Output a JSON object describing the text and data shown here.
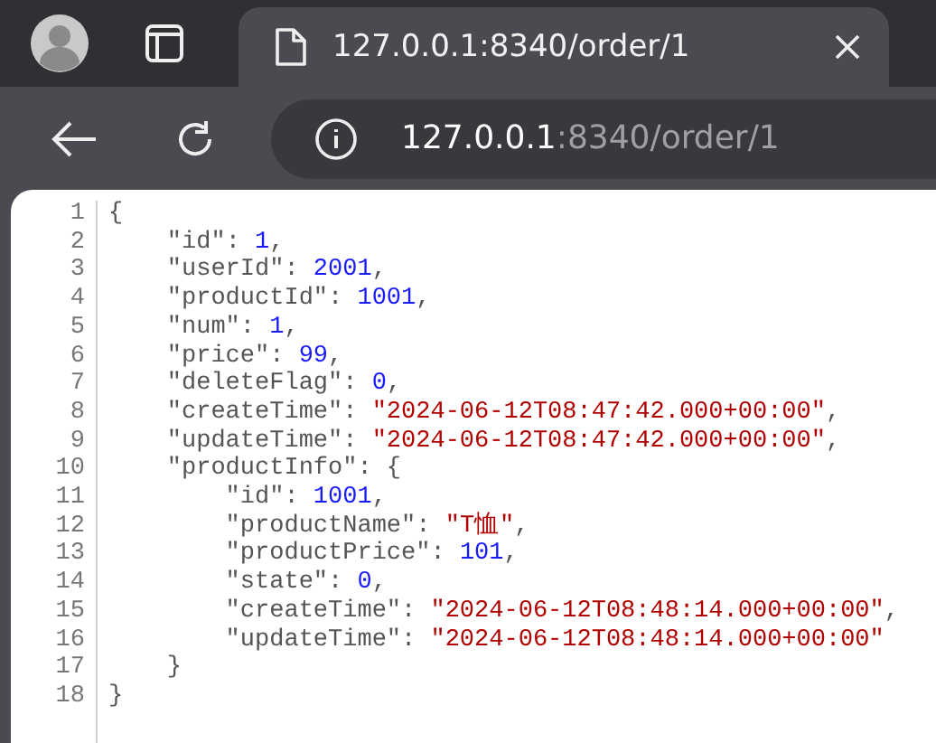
{
  "tab": {
    "title": "127.0.0.1:8340/order/1",
    "selected": true
  },
  "address": {
    "host": "127.0.0.1",
    "rest": ":8340/order/1"
  },
  "code_lines": [
    {
      "number": "1",
      "tokens": [
        {
          "kind": "punct",
          "text": "{"
        }
      ]
    },
    {
      "number": "2",
      "tokens": [
        {
          "kind": "key",
          "text": "    \"id\""
        },
        {
          "kind": "punct",
          "text": ": "
        },
        {
          "kind": "number",
          "text": "1"
        },
        {
          "kind": "punct",
          "text": ","
        }
      ]
    },
    {
      "number": "3",
      "tokens": [
        {
          "kind": "key",
          "text": "    \"userId\""
        },
        {
          "kind": "punct",
          "text": ": "
        },
        {
          "kind": "number",
          "text": "2001"
        },
        {
          "kind": "punct",
          "text": ","
        }
      ]
    },
    {
      "number": "4",
      "tokens": [
        {
          "kind": "key",
          "text": "    \"productId\""
        },
        {
          "kind": "punct",
          "text": ": "
        },
        {
          "kind": "number",
          "text": "1001"
        },
        {
          "kind": "punct",
          "text": ","
        }
      ]
    },
    {
      "number": "5",
      "tokens": [
        {
          "kind": "key",
          "text": "    \"num\""
        },
        {
          "kind": "punct",
          "text": ": "
        },
        {
          "kind": "number",
          "text": "1"
        },
        {
          "kind": "punct",
          "text": ","
        }
      ]
    },
    {
      "number": "6",
      "tokens": [
        {
          "kind": "key",
          "text": "    \"price\""
        },
        {
          "kind": "punct",
          "text": ": "
        },
        {
          "kind": "number",
          "text": "99"
        },
        {
          "kind": "punct",
          "text": ","
        }
      ]
    },
    {
      "number": "7",
      "tokens": [
        {
          "kind": "key",
          "text": "    \"deleteFlag\""
        },
        {
          "kind": "punct",
          "text": ": "
        },
        {
          "kind": "number",
          "text": "0"
        },
        {
          "kind": "punct",
          "text": ","
        }
      ]
    },
    {
      "number": "8",
      "tokens": [
        {
          "kind": "key",
          "text": "    \"createTime\""
        },
        {
          "kind": "punct",
          "text": ": "
        },
        {
          "kind": "string",
          "text": "\"2024-06-12T08:47:42.000+00:00\""
        },
        {
          "kind": "punct",
          "text": ","
        }
      ]
    },
    {
      "number": "9",
      "tokens": [
        {
          "kind": "key",
          "text": "    \"updateTime\""
        },
        {
          "kind": "punct",
          "text": ": "
        },
        {
          "kind": "string",
          "text": "\"2024-06-12T08:47:42.000+00:00\""
        },
        {
          "kind": "punct",
          "text": ","
        }
      ]
    },
    {
      "number": "10",
      "tokens": [
        {
          "kind": "key",
          "text": "    \"productInfo\""
        },
        {
          "kind": "punct",
          "text": ": {"
        }
      ]
    },
    {
      "number": "11",
      "tokens": [
        {
          "kind": "key",
          "text": "        \"id\""
        },
        {
          "kind": "punct",
          "text": ": "
        },
        {
          "kind": "number",
          "text": "1001"
        },
        {
          "kind": "punct",
          "text": ","
        }
      ]
    },
    {
      "number": "12",
      "tokens": [
        {
          "kind": "key",
          "text": "        \"productName\""
        },
        {
          "kind": "punct",
          "text": ": "
        },
        {
          "kind": "string",
          "text": "\"T恤\""
        },
        {
          "kind": "punct",
          "text": ","
        }
      ]
    },
    {
      "number": "13",
      "tokens": [
        {
          "kind": "key",
          "text": "        \"productPrice\""
        },
        {
          "kind": "punct",
          "text": ": "
        },
        {
          "kind": "number",
          "text": "101"
        },
        {
          "kind": "punct",
          "text": ","
        }
      ]
    },
    {
      "number": "14",
      "tokens": [
        {
          "kind": "key",
          "text": "        \"state\""
        },
        {
          "kind": "punct",
          "text": ": "
        },
        {
          "kind": "number",
          "text": "0"
        },
        {
          "kind": "punct",
          "text": ","
        }
      ]
    },
    {
      "number": "15",
      "tokens": [
        {
          "kind": "key",
          "text": "        \"createTime\""
        },
        {
          "kind": "punct",
          "text": ": "
        },
        {
          "kind": "string",
          "text": "\"2024-06-12T08:48:14.000+00:00\""
        },
        {
          "kind": "punct",
          "text": ","
        }
      ]
    },
    {
      "number": "16",
      "tokens": [
        {
          "kind": "key",
          "text": "        \"updateTime\""
        },
        {
          "kind": "punct",
          "text": ": "
        },
        {
          "kind": "string",
          "text": "\"2024-06-12T08:48:14.000+00:00\""
        }
      ]
    },
    {
      "number": "17",
      "tokens": [
        {
          "kind": "punct",
          "text": "    }"
        }
      ]
    },
    {
      "number": "18",
      "tokens": [
        {
          "kind": "punct",
          "text": "}"
        }
      ]
    }
  ]
}
